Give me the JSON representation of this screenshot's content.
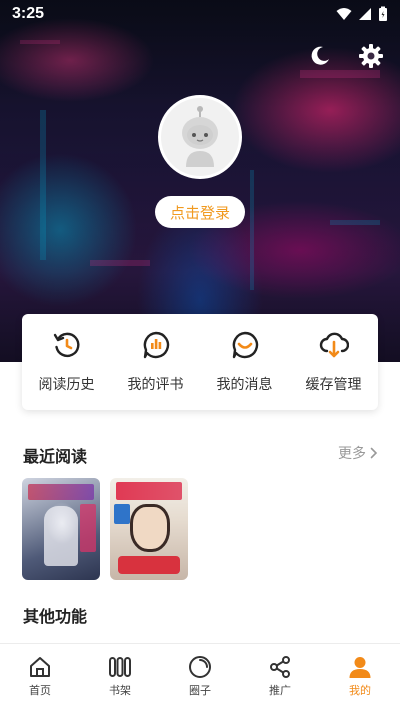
{
  "status_bar": {
    "time": "3:25"
  },
  "header": {
    "night_mode_icon": "moon-icon",
    "settings_icon": "gear-icon"
  },
  "profile": {
    "avatar_icon": "robot-avatar-icon",
    "login_label": "点击登录"
  },
  "quick_actions": [
    {
      "label": "阅读历史",
      "icon": "history-icon"
    },
    {
      "label": "我的评书",
      "icon": "comment-chart-icon"
    },
    {
      "label": "我的消息",
      "icon": "message-smile-icon"
    },
    {
      "label": "缓存管理",
      "icon": "cloud-download-icon"
    }
  ],
  "recent": {
    "title": "最近阅读",
    "more_label": "更多"
  },
  "other": {
    "title": "其他功能"
  },
  "bottom_nav": [
    {
      "label": "首页",
      "icon": "home-icon",
      "active": false
    },
    {
      "label": "书架",
      "icon": "bookshelf-icon",
      "active": false
    },
    {
      "label": "圈子",
      "icon": "circle-icon",
      "active": false
    },
    {
      "label": "推广",
      "icon": "share-icon",
      "active": false
    },
    {
      "label": "我的",
      "icon": "user-icon",
      "active": true
    }
  ],
  "colors": {
    "accent": "#f28a18",
    "login_text": "#f19a20"
  }
}
